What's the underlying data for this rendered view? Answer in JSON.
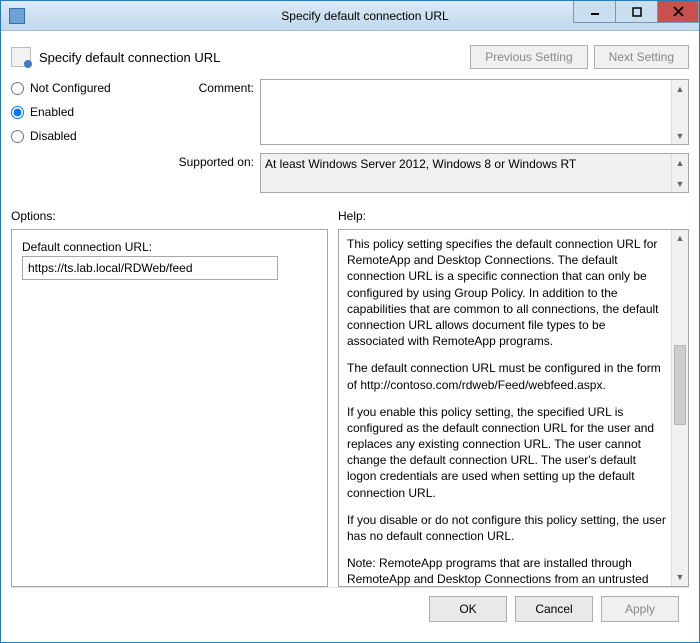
{
  "title": "Specify default connection URL",
  "header_label": "Specify default connection URL",
  "nav": {
    "prev": "Previous Setting",
    "next": "Next Setting"
  },
  "states": {
    "not_configured": "Not Configured",
    "enabled": "Enabled",
    "disabled": "Disabled",
    "selected": "enabled"
  },
  "labels": {
    "comment": "Comment:",
    "supported": "Supported on:",
    "options": "Options:",
    "help": "Help:",
    "default_url": "Default connection URL:"
  },
  "comment_value": "",
  "supported_value": "At least Windows Server 2012, Windows 8 or Windows RT",
  "default_url_value": "https://ts.lab.local/RDWeb/feed",
  "help": {
    "p1": "This policy setting specifies the default connection URL for RemoteApp and Desktop Connections. The default connection URL is a specific connection that can only be configured by using Group Policy. In addition to the capabilities that are common to all connections, the default connection URL allows document file types to be associated with RemoteApp programs.",
    "p2": "The default connection URL must be configured in the form of http://contoso.com/rdweb/Feed/webfeed.aspx.",
    "p3": "If you enable this policy setting, the specified URL is configured as the default connection URL for the user and replaces any existing connection URL. The user cannot change the default connection URL. The user's default logon credentials are used when setting up the default connection URL.",
    "p4": "If you disable or do not configure this policy setting, the user has no default connection URL.",
    "p5": "Note: RemoteApp programs that are installed through RemoteApp and Desktop Connections from an untrusted server"
  },
  "buttons": {
    "ok": "OK",
    "cancel": "Cancel",
    "apply": "Apply"
  }
}
